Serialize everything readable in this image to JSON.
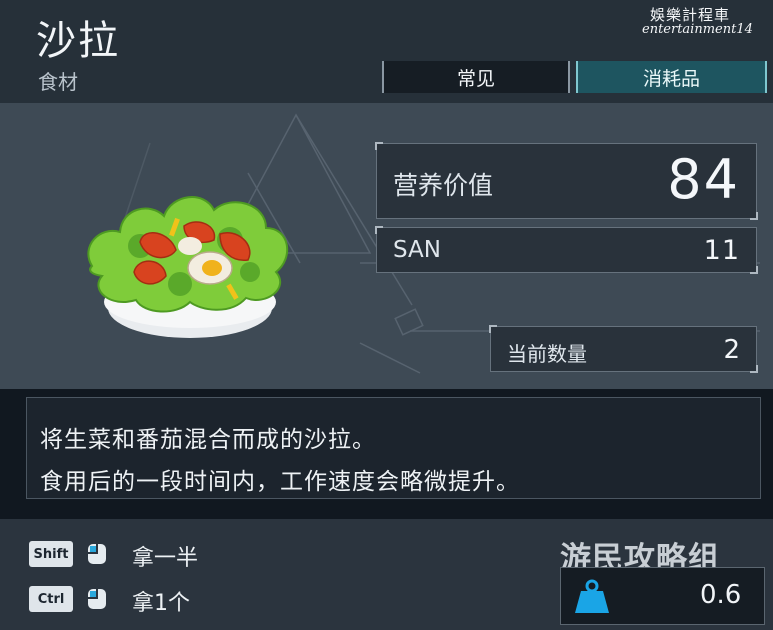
{
  "header": {
    "title": "沙拉",
    "subtitle": "食材",
    "tags": [
      "常见",
      "消耗品"
    ]
  },
  "watermark": {
    "cn": "娛樂計程車",
    "en": "entertainment14"
  },
  "item": {
    "icon": "salad-bowl-icon"
  },
  "stats": {
    "nutrition_label": "营养价值",
    "nutrition_value": "84",
    "san_label": "SAN",
    "san_value": "11",
    "quantity_label": "当前数量",
    "quantity_value": "2"
  },
  "description": {
    "line1": "将生菜和番茄混合而成的沙拉。",
    "line2": "食用后的一段时间内，工作速度会略微提升。"
  },
  "controls": [
    {
      "key": "Shift",
      "icon": "mouse-icon",
      "label": "拿一半"
    },
    {
      "key": "Ctrl",
      "icon": "mouse-icon",
      "label": "拿1个"
    }
  ],
  "weight": {
    "icon": "weight-icon",
    "value": "0.6"
  },
  "brand_watermark": "游民攻略组",
  "colors": {
    "accent": "#1e5560",
    "weight_icon": "#1aa5e6"
  }
}
